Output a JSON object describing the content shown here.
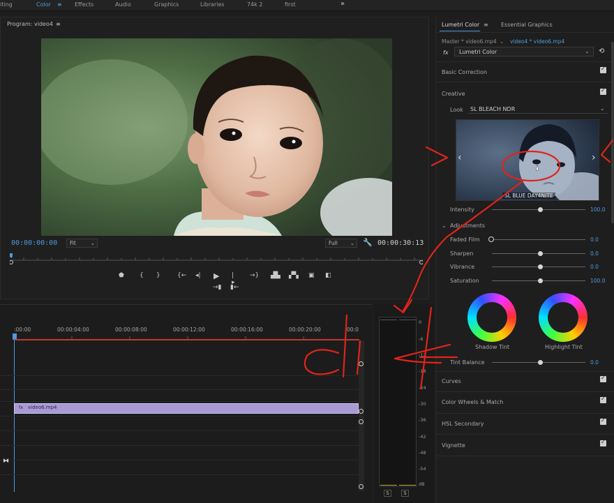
{
  "workspaces": {
    "editing": "iting",
    "color": "Color",
    "effects": "Effects",
    "audio": "Audio",
    "graphics": "Graphics",
    "libraries": "Libraries",
    "custom1": "74k 2",
    "custom2": "first",
    "more": "»"
  },
  "program": {
    "title": "Program: video4",
    "menu_icon": "≡",
    "timecode_current": "00:00:00:00",
    "timecode_duration": "00:00:30:13",
    "fit_label": "Fit",
    "quality_label": "Full"
  },
  "timeline": {
    "times": [
      ":00:00",
      "00:00:04:00",
      "00:00:08:00",
      "00:00:12:00",
      "00:00:16:00",
      "00:00:20:00",
      "00:0"
    ],
    "clip_label": "video6.mp4"
  },
  "meter": {
    "ticks": [
      "0",
      "-6",
      "-12",
      "-18",
      "-24",
      "-30",
      "-36",
      "-42",
      "-48",
      "-54",
      "dB"
    ],
    "solo_left": "S",
    "solo_right": "S"
  },
  "lumetri": {
    "tab_active": "Lumetri Color",
    "tab_other": "Essential Graphics",
    "master_clip": "Master * video6.mp4",
    "seq_clip": "video4 * video6.mp4",
    "fx_label": "fx",
    "effect_name": "Lumetri Color",
    "basic_correction": "Basic Correction",
    "creative": "Creative",
    "look_label": "Look",
    "look_value": "SL BLEACH NDR",
    "preview_caption": "SL BLUE DAY4NITE",
    "intensity_label": "Intensity",
    "intensity_value": "100.0",
    "adjustments": "Adjustments",
    "faded_film_label": "Faded Film",
    "faded_film_value": "0.0",
    "sharpen_label": "Sharpen",
    "sharpen_value": "0.0",
    "vibrance_label": "Vibrance",
    "vibrance_value": "0.0",
    "saturation_label": "Saturation",
    "saturation_value": "100.0",
    "shadow_tint": "Shadow Tint",
    "highlight_tint": "Highlight Tint",
    "tint_balance_label": "Tint Balance",
    "tint_balance_value": "0.0",
    "curves": "Curves",
    "color_wheels": "Color Wheels & Match",
    "hsl": "HSL Secondary",
    "vignette": "Vignette"
  },
  "annotation": {
    "handwritten_text": "click"
  },
  "colors": {
    "accent_blue": "#4d9de0",
    "annotation_red": "#e0241b",
    "clip_purple": "#a89bd4",
    "playhead_red": "#c0392b"
  }
}
